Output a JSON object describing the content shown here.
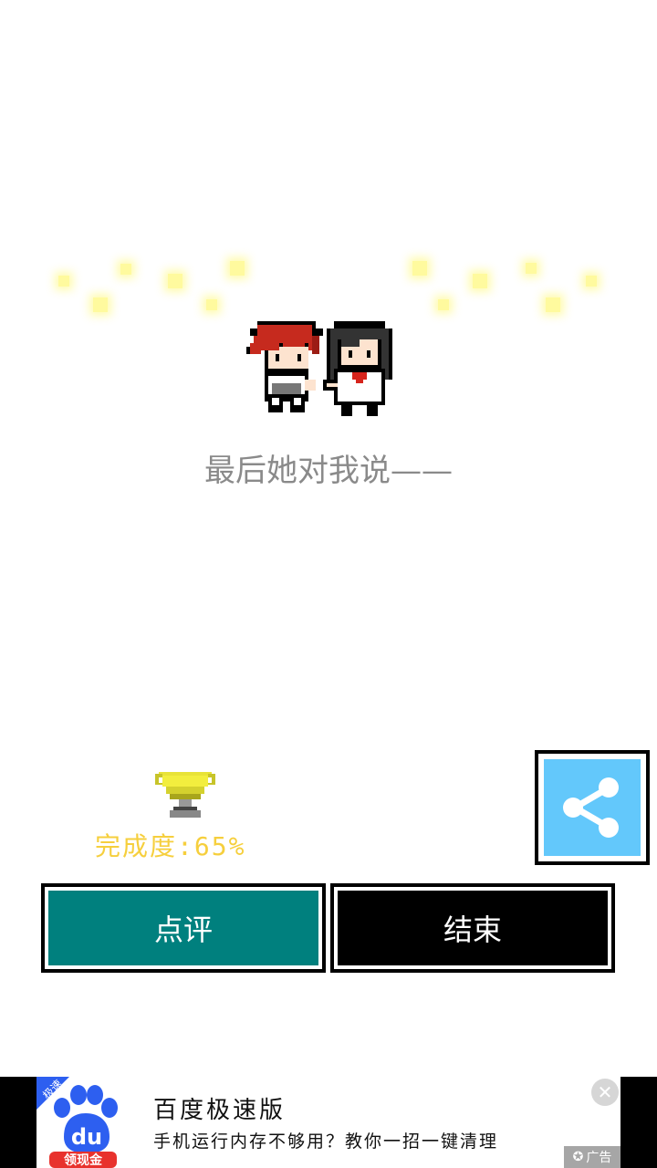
{
  "ending": {
    "line": "最后她对我说——"
  },
  "progress": {
    "label": "完成度:65%",
    "value_percent": 65
  },
  "buttons": {
    "review_label": "点评",
    "end_label": "结束"
  },
  "share": {
    "icon": "share-icon",
    "color": "#63c8fb"
  },
  "ad": {
    "logo_corner": "极速",
    "logo_main": "du",
    "logo_banner": "领现金",
    "title": "百度极速版",
    "description": "手机运行内存不够用？教你一招一键清理",
    "badge": "广告",
    "close_icon": "close-icon"
  },
  "colors": {
    "review_button": "#00807e",
    "end_button": "#000000",
    "completion_text": "#f6cf3d",
    "ending_text": "#8a8a8a"
  }
}
